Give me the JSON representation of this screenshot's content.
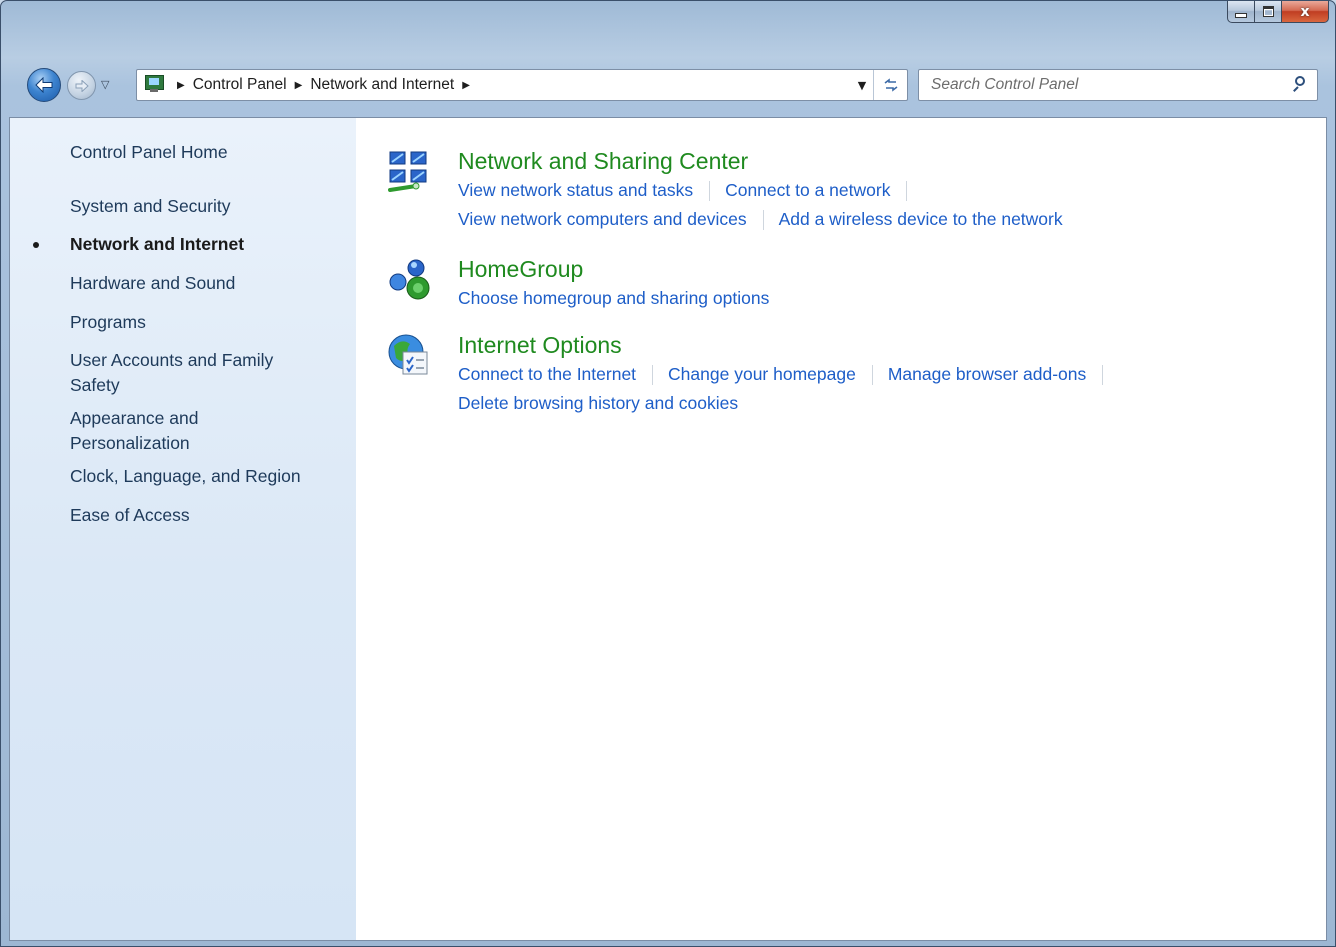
{
  "window": {
    "caption_buttons": {
      "minimize": "minimize",
      "maximize": "maximize",
      "close": "x"
    }
  },
  "nav": {
    "breadcrumb": [
      "Control Panel",
      "Network and Internet"
    ],
    "search_placeholder": "Search Control Panel"
  },
  "sidebar": {
    "items": [
      {
        "label": "Control Panel Home",
        "active": false
      },
      {
        "label": "System and Security",
        "active": false
      },
      {
        "label": "Network and Internet",
        "active": true
      },
      {
        "label": "Hardware and Sound",
        "active": false
      },
      {
        "label": "Programs",
        "active": false
      },
      {
        "label": "User Accounts and Family Safety",
        "active": false
      },
      {
        "label": "Appearance and Personalization",
        "active": false
      },
      {
        "label": "Clock, Language, and Region",
        "active": false
      },
      {
        "label": "Ease of Access",
        "active": false
      }
    ]
  },
  "categories": [
    {
      "title": "Network and Sharing Center",
      "icon": "network-sharing-icon",
      "links": [
        "View network status and tasks",
        "Connect to a network",
        "View network computers and devices",
        "Add a wireless device to the network"
      ]
    },
    {
      "title": "HomeGroup",
      "icon": "homegroup-icon",
      "links": [
        "Choose homegroup and sharing options"
      ]
    },
    {
      "title": "Internet Options",
      "icon": "internet-options-icon",
      "links": [
        "Connect to the Internet",
        "Change your homepage",
        "Manage browser add-ons",
        "Delete browsing history and cookies"
      ]
    }
  ],
  "colors": {
    "category_title": "#1f8a1f",
    "link": "#1e5ec8",
    "sidebar_text": "#1e3a5a"
  }
}
